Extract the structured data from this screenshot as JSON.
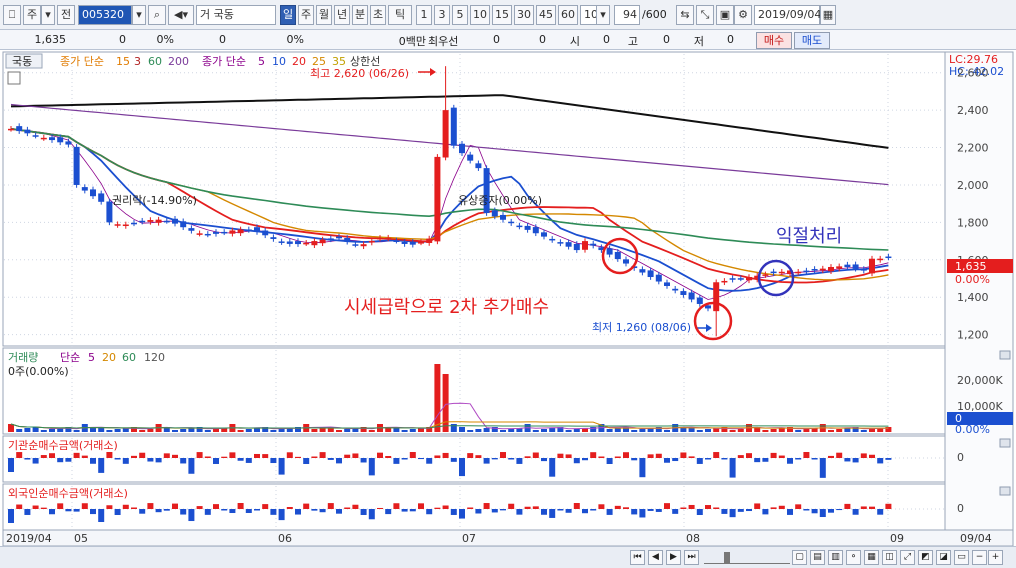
{
  "toolbar": {
    "market": "주",
    "prev_label": "전",
    "code": "005320",
    "name": "국동",
    "period_labels": [
      "일",
      "주",
      "월",
      "년",
      "분",
      "초",
      "틱"
    ],
    "interval_labels": [
      "1",
      "3",
      "5",
      "10",
      "15",
      "30",
      "45",
      "60"
    ],
    "interval_value": "10",
    "count": "94",
    "count_total": "/600",
    "date": "2019/09/04"
  },
  "status": {
    "price": "1,635",
    "change": "0",
    "change_pct": "0%",
    "volume": "0",
    "volume_pct": "0%",
    "amount": "0백만",
    "priority_label": "최우선",
    "priority_values": [
      "0",
      "0"
    ],
    "open_label": "시",
    "open": "0",
    "high_label": "고",
    "high": "0",
    "low_label": "저",
    "low": "0",
    "buy_label": "매수",
    "sell_label": "매도"
  },
  "price_panel": {
    "stock_label": "국동",
    "ma1_label": "종가 단순",
    "ma1_periods": [
      "15",
      "3",
      "60",
      "200"
    ],
    "ma2_label": "종가 단순",
    "ma2_periods": [
      "5",
      "10",
      "20",
      "25",
      "35"
    ],
    "limit_label": "상한선",
    "lc_label": "LC:29.76",
    "hc_label": "HC:-42.02",
    "high_annotation": "최고 2,620 (06/26)",
    "low_annotation": "최저 1,260 (08/06)",
    "event1": "권리락(-14.90%)",
    "event2": "유상증자(0.00%)",
    "annotation_buy": "시세급락으로 2차 추가매수",
    "annotation_profit": "익절처리",
    "current_price": "1,635",
    "current_pct": "0.00%",
    "y_ticks": [
      "2,600",
      "2,400",
      "2,200",
      "2,000",
      "1,800",
      "1,600",
      "1,400",
      "1,200"
    ],
    "colors": {
      "up": "#e41e1e",
      "down": "#1b4fd0",
      "accent": "#e41e1e",
      "profit_circle": "#3333bb"
    }
  },
  "volume_panel": {
    "title": "거래량",
    "ma_label": "단순",
    "ma_periods": [
      "5",
      "20",
      "60",
      "120"
    ],
    "summary": "0주(0.00%)",
    "y_ticks": [
      "20,000K",
      "10,000K"
    ],
    "current": "0",
    "current_pct": "0.00%"
  },
  "inst_panel": {
    "title": "기관순매수금액(거래소)",
    "tick": "0"
  },
  "foreign_panel": {
    "title": "외국인순매수금액(거래소)",
    "tick": "0"
  },
  "x_axis": {
    "labels": [
      "2019/04",
      "05",
      "06",
      "07",
      "08",
      "09",
      "09/04"
    ]
  },
  "chart_data": {
    "type": "candlestick",
    "title": "",
    "ylim": [
      1150,
      2700
    ],
    "date_range": [
      "2019/04",
      "2019/09/04"
    ],
    "annotations": [
      {
        "text": "최고 2,620 (06/26)",
        "value": 2620
      },
      {
        "text": "최저 1,260 (08/06)",
        "value": 1260
      }
    ]
  }
}
